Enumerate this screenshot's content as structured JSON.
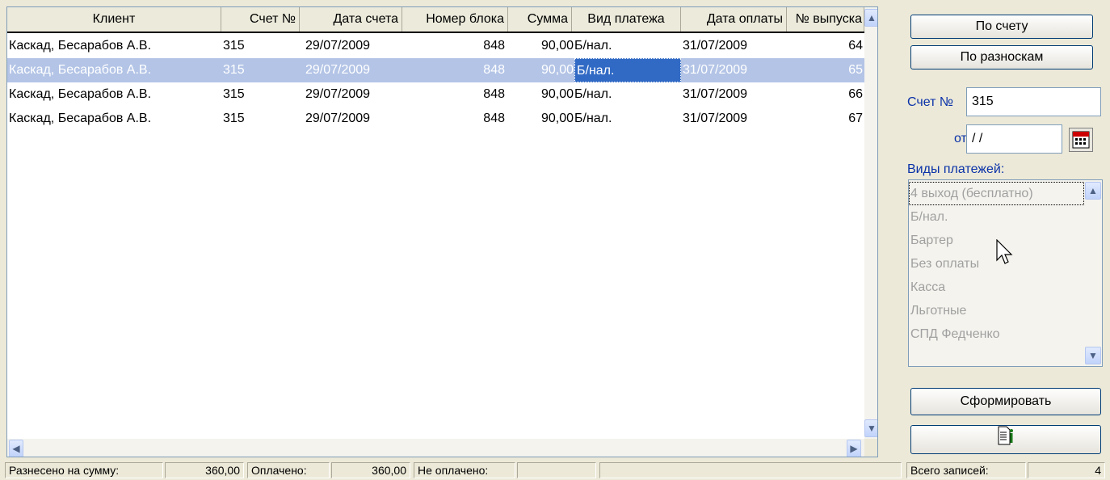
{
  "grid": {
    "columns": [
      {
        "label": "Клиент"
      },
      {
        "label": "Счет №"
      },
      {
        "label": "Дата счета"
      },
      {
        "label": "Номер блока"
      },
      {
        "label": "Сумма"
      },
      {
        "label": "Вид платежа"
      },
      {
        "label": "Дата оплаты"
      },
      {
        "label": "№ выпуска"
      }
    ],
    "rows": [
      {
        "client": "Каскад, Бесарабов А.В.",
        "invoice": "315",
        "invoice_date": "29/07/2009",
        "block": "848",
        "sum": "90,00",
        "pay_type": "Б/нал.",
        "pay_date": "31/07/2009",
        "issue": "64",
        "selected": false
      },
      {
        "client": "Каскад, Бесарабов А.В.",
        "invoice": "315",
        "invoice_date": "29/07/2009",
        "block": "848",
        "sum": "90,00",
        "pay_type": "Б/нал.",
        "pay_date": "31/07/2009",
        "issue": "65",
        "selected": true
      },
      {
        "client": "Каскад, Бесарабов А.В.",
        "invoice": "315",
        "invoice_date": "29/07/2009",
        "block": "848",
        "sum": "90,00",
        "pay_type": "Б/нал.",
        "pay_date": "31/07/2009",
        "issue": "66",
        "selected": false
      },
      {
        "client": "Каскад, Бесарабов А.В.",
        "invoice": "315",
        "invoice_date": "29/07/2009",
        "block": "848",
        "sum": "90,00",
        "pay_type": "Б/нал.",
        "pay_date": "31/07/2009",
        "issue": "67",
        "selected": false
      }
    ]
  },
  "panel": {
    "by_invoice_label": "По счету",
    "by_postings_label": "По разноскам",
    "invoice_no_label": "Счет №",
    "invoice_no_value": "315",
    "from_label": "от",
    "from_value": " / /",
    "payment_types_label": "Виды платежей:",
    "payment_types": [
      "4 выход (бесплатно)",
      "Б/нал.",
      "Бартер",
      "Без оплаты",
      "Касса",
      "Льготные",
      "СПД Федченко"
    ],
    "generate_label": "Сформировать",
    "report_icon": "report-info-icon",
    "calendar_icon": "calendar-icon"
  },
  "status": {
    "posted_label": "Разнесено на сумму:",
    "posted_value": "360,00",
    "paid_label": "Оплачено:",
    "paid_value": "360,00",
    "unpaid_label": "Не оплачено:",
    "unpaid_value": "",
    "total_label": "Всего записей:",
    "total_value": "4"
  },
  "colors": {
    "selection": "#b3c4e6",
    "edit_cell": "#316ac5",
    "label_blue": "#0a32a8"
  }
}
